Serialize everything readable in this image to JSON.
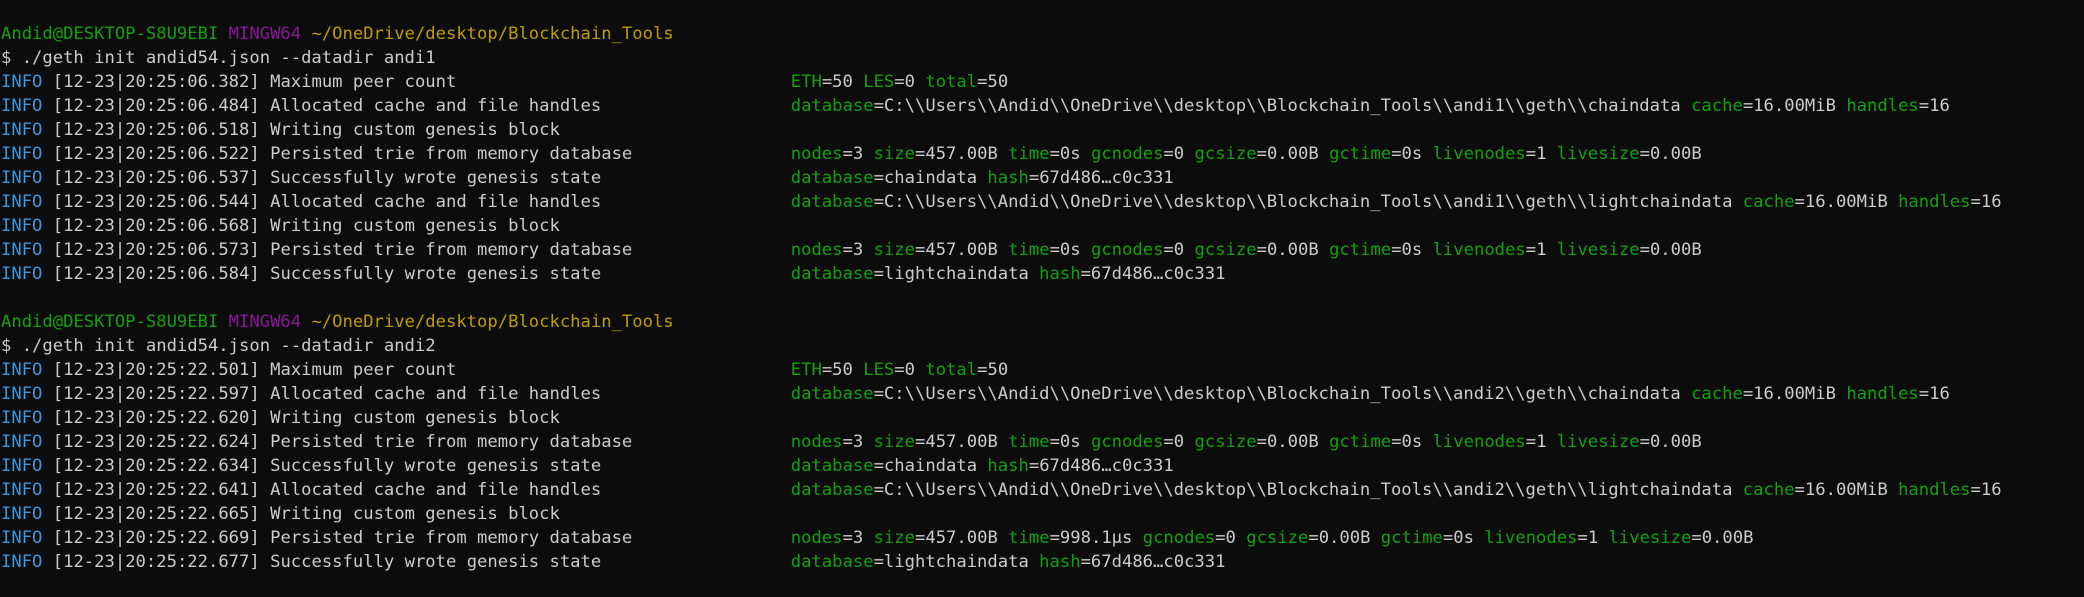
{
  "colors": {
    "background": "#0c0c0c",
    "text": "#cccccc",
    "user_host": "#13a10e",
    "shell_name": "#881798",
    "path": "#c19c00",
    "log_level": "#3a96dd",
    "field_key": "#13a10e"
  },
  "sessions": [
    {
      "prompt": {
        "user_host": "Andid@DESKTOP-S8U9EBI",
        "shell": "MINGW64",
        "path": "~/OneDrive/desktop/Blockchain_Tools"
      },
      "command": "$ ./geth init andid54.json --datadir andi1",
      "logs": [
        {
          "level": "INFO",
          "time": "[12-23|20:25:06.382]",
          "message": "Maximum peer count",
          "fields": [
            {
              "k": "ETH",
              "v": "50"
            },
            {
              "k": "LES",
              "v": "0"
            },
            {
              "k": "total",
              "v": "50"
            }
          ]
        },
        {
          "level": "INFO",
          "time": "[12-23|20:25:06.484]",
          "message": "Allocated cache and file handles",
          "fields": [
            {
              "k": "database",
              "v": "C:\\\\Users\\\\Andid\\\\OneDrive\\\\desktop\\\\Blockchain_Tools\\\\andi1\\\\geth\\\\chaindata"
            },
            {
              "k": "cache",
              "v": "16.00MiB"
            },
            {
              "k": "handles",
              "v": "16"
            }
          ]
        },
        {
          "level": "INFO",
          "time": "[12-23|20:25:06.518]",
          "message": "Writing custom genesis block",
          "fields": []
        },
        {
          "level": "INFO",
          "time": "[12-23|20:25:06.522]",
          "message": "Persisted trie from memory database",
          "fields": [
            {
              "k": "nodes",
              "v": "3"
            },
            {
              "k": "size",
              "v": "457.00B"
            },
            {
              "k": "time",
              "v": "0s"
            },
            {
              "k": "gcnodes",
              "v": "0"
            },
            {
              "k": "gcsize",
              "v": "0.00B"
            },
            {
              "k": "gctime",
              "v": "0s"
            },
            {
              "k": "livenodes",
              "v": "1"
            },
            {
              "k": "livesize",
              "v": "0.00B"
            }
          ]
        },
        {
          "level": "INFO",
          "time": "[12-23|20:25:06.537]",
          "message": "Successfully wrote genesis state",
          "fields": [
            {
              "k": "database",
              "v": "chaindata"
            },
            {
              "k": "hash",
              "v": "67d486…c0c331"
            }
          ]
        },
        {
          "level": "INFO",
          "time": "[12-23|20:25:06.544]",
          "message": "Allocated cache and file handles",
          "fields": [
            {
              "k": "database",
              "v": "C:\\\\Users\\\\Andid\\\\OneDrive\\\\desktop\\\\Blockchain_Tools\\\\andi1\\\\geth\\\\lightchaindata"
            },
            {
              "k": "cache",
              "v": "16.00MiB"
            },
            {
              "k": "handles",
              "v": "16"
            }
          ]
        },
        {
          "level": "INFO",
          "time": "[12-23|20:25:06.568]",
          "message": "Writing custom genesis block",
          "fields": []
        },
        {
          "level": "INFO",
          "time": "[12-23|20:25:06.573]",
          "message": "Persisted trie from memory database",
          "fields": [
            {
              "k": "nodes",
              "v": "3"
            },
            {
              "k": "size",
              "v": "457.00B"
            },
            {
              "k": "time",
              "v": "0s"
            },
            {
              "k": "gcnodes",
              "v": "0"
            },
            {
              "k": "gcsize",
              "v": "0.00B"
            },
            {
              "k": "gctime",
              "v": "0s"
            },
            {
              "k": "livenodes",
              "v": "1"
            },
            {
              "k": "livesize",
              "v": "0.00B"
            }
          ]
        },
        {
          "level": "INFO",
          "time": "[12-23|20:25:06.584]",
          "message": "Successfully wrote genesis state",
          "fields": [
            {
              "k": "database",
              "v": "lightchaindata"
            },
            {
              "k": "hash",
              "v": "67d486…c0c331"
            }
          ]
        }
      ]
    },
    {
      "prompt": {
        "user_host": "Andid@DESKTOP-S8U9EBI",
        "shell": "MINGW64",
        "path": "~/OneDrive/desktop/Blockchain_Tools"
      },
      "command": "$ ./geth init andid54.json --datadir andi2",
      "logs": [
        {
          "level": "INFO",
          "time": "[12-23|20:25:22.501]",
          "message": "Maximum peer count",
          "fields": [
            {
              "k": "ETH",
              "v": "50"
            },
            {
              "k": "LES",
              "v": "0"
            },
            {
              "k": "total",
              "v": "50"
            }
          ]
        },
        {
          "level": "INFO",
          "time": "[12-23|20:25:22.597]",
          "message": "Allocated cache and file handles",
          "fields": [
            {
              "k": "database",
              "v": "C:\\\\Users\\\\Andid\\\\OneDrive\\\\desktop\\\\Blockchain_Tools\\\\andi2\\\\geth\\\\chaindata"
            },
            {
              "k": "cache",
              "v": "16.00MiB"
            },
            {
              "k": "handles",
              "v": "16"
            }
          ]
        },
        {
          "level": "INFO",
          "time": "[12-23|20:25:22.620]",
          "message": "Writing custom genesis block",
          "fields": []
        },
        {
          "level": "INFO",
          "time": "[12-23|20:25:22.624]",
          "message": "Persisted trie from memory database",
          "fields": [
            {
              "k": "nodes",
              "v": "3"
            },
            {
              "k": "size",
              "v": "457.00B"
            },
            {
              "k": "time",
              "v": "0s"
            },
            {
              "k": "gcnodes",
              "v": "0"
            },
            {
              "k": "gcsize",
              "v": "0.00B"
            },
            {
              "k": "gctime",
              "v": "0s"
            },
            {
              "k": "livenodes",
              "v": "1"
            },
            {
              "k": "livesize",
              "v": "0.00B"
            }
          ]
        },
        {
          "level": "INFO",
          "time": "[12-23|20:25:22.634]",
          "message": "Successfully wrote genesis state",
          "fields": [
            {
              "k": "database",
              "v": "chaindata"
            },
            {
              "k": "hash",
              "v": "67d486…c0c331"
            }
          ]
        },
        {
          "level": "INFO",
          "time": "[12-23|20:25:22.641]",
          "message": "Allocated cache and file handles",
          "fields": [
            {
              "k": "database",
              "v": "C:\\\\Users\\\\Andid\\\\OneDrive\\\\desktop\\\\Blockchain_Tools\\\\andi2\\\\geth\\\\lightchaindata"
            },
            {
              "k": "cache",
              "v": "16.00MiB"
            },
            {
              "k": "handles",
              "v": "16"
            }
          ]
        },
        {
          "level": "INFO",
          "time": "[12-23|20:25:22.665]",
          "message": "Writing custom genesis block",
          "fields": []
        },
        {
          "level": "INFO",
          "time": "[12-23|20:25:22.669]",
          "message": "Persisted trie from memory database",
          "fields": [
            {
              "k": "nodes",
              "v": "3"
            },
            {
              "k": "size",
              "v": "457.00B"
            },
            {
              "k": "time",
              "v": "998.1µs"
            },
            {
              "k": "gcnodes",
              "v": "0"
            },
            {
              "k": "gcsize",
              "v": "0.00B"
            },
            {
              "k": "gctime",
              "v": "0s"
            },
            {
              "k": "livenodes",
              "v": "1"
            },
            {
              "k": "livesize",
              "v": "0.00B"
            }
          ]
        },
        {
          "level": "INFO",
          "time": "[12-23|20:25:22.677]",
          "message": "Successfully wrote genesis state",
          "fields": [
            {
              "k": "database",
              "v": "lightchaindata"
            },
            {
              "k": "hash",
              "v": "67d486…c0c331"
            }
          ]
        }
      ]
    }
  ]
}
